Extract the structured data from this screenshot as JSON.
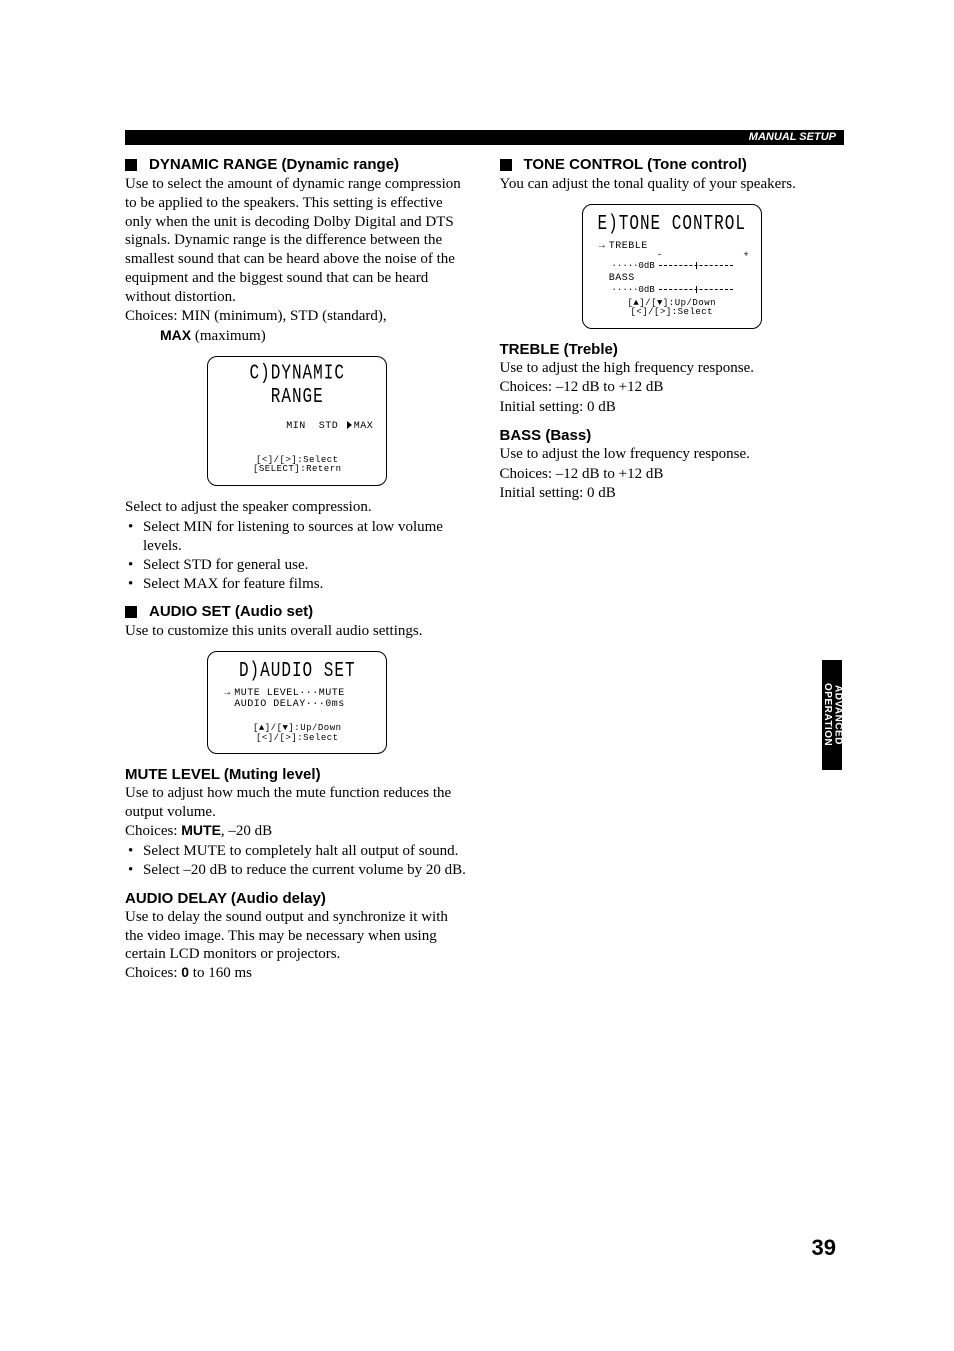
{
  "header": {
    "section_label": "MANUAL SETUP"
  },
  "left": {
    "dynamic_range": {
      "title": "DYNAMIC RANGE (Dynamic range)",
      "p1": "Use to select the amount of dynamic range compression to be applied to the speakers. This setting is effective only when the unit is decoding Dolby Digital and DTS signals. Dynamic range is the difference between the smallest sound that can be heard above the noise of the equipment and the biggest sound that can be heard without distortion.",
      "choices_prefix": "Choices: MIN (minimum), STD (standard),",
      "choices_line2_bold": "MAX",
      "choices_line2_rest": " (maximum)",
      "lcd_title": "C)DYNAMIC RANGE",
      "lcd_opts_min": "MIN",
      "lcd_opts_std": "STD",
      "lcd_opts_max": "MAX",
      "lcd_foot1": "[<]/[>]:Select",
      "lcd_foot2": "[SELECT]:Retern",
      "after_lcd": "Select to adjust the speaker compression.",
      "bullet1": "Select MIN for listening to sources at low volume levels.",
      "bullet2": "Select STD for general use.",
      "bullet3": "Select MAX for feature films."
    },
    "audio_set": {
      "title": "AUDIO SET (Audio set)",
      "p1": "Use to customize this units overall audio settings.",
      "lcd_title": "D)AUDIO SET",
      "lcd_row1": "MUTE LEVEL···MUTE",
      "lcd_row2": "AUDIO DELAY···0ms",
      "lcd_foot1": "[▲]/[▼]:Up/Down",
      "lcd_foot2": "[<]/[>]:Select"
    },
    "mute_level": {
      "title": "MUTE LEVEL (Muting level)",
      "p1": "Use to adjust how much the mute function reduces the output volume.",
      "choices_prefix": "Choices: ",
      "choices_bold": "MUTE",
      "choices_suffix": ", –20 dB",
      "bullet1": "Select MUTE to completely halt all output of sound.",
      "bullet2": "Select –20 dB to reduce the current volume by 20 dB."
    },
    "audio_delay": {
      "title": "AUDIO DELAY (Audio delay)",
      "p1": "Use to delay the sound output and synchronize it with the video image. This may be necessary when using certain LCD monitors or projectors.",
      "choices_prefix": "Choices: ",
      "choices_bold": "0",
      "choices_suffix": " to 160 ms"
    }
  },
  "right": {
    "tone_control": {
      "title": "TONE CONTROL (Tone control)",
      "p1": "You can adjust the tonal quality of your speakers.",
      "lcd_title": "E)TONE CONTROL",
      "lcd_treble_label": "TREBLE",
      "lcd_bass_label": "BASS",
      "lcd_db": "·····0dB",
      "lcd_minus": "-",
      "lcd_plus": "+",
      "lcd_foot1": "[▲]/[▼]:Up/Down",
      "lcd_foot2": "[<]/[>]:Select"
    },
    "treble": {
      "title": "TREBLE (Treble)",
      "p1": "Use to adjust the high frequency response.",
      "choices": "Choices: –12 dB to +12 dB",
      "initial": "Initial setting: 0 dB"
    },
    "bass": {
      "title": "BASS (Bass)",
      "p1": "Use to adjust the low frequency response.",
      "choices": "Choices: –12 dB to +12 dB",
      "initial": "Initial setting: 0 dB"
    }
  },
  "side_tab": {
    "line1": "ADVANCED",
    "line2": "OPERATION"
  },
  "page_number": "39"
}
